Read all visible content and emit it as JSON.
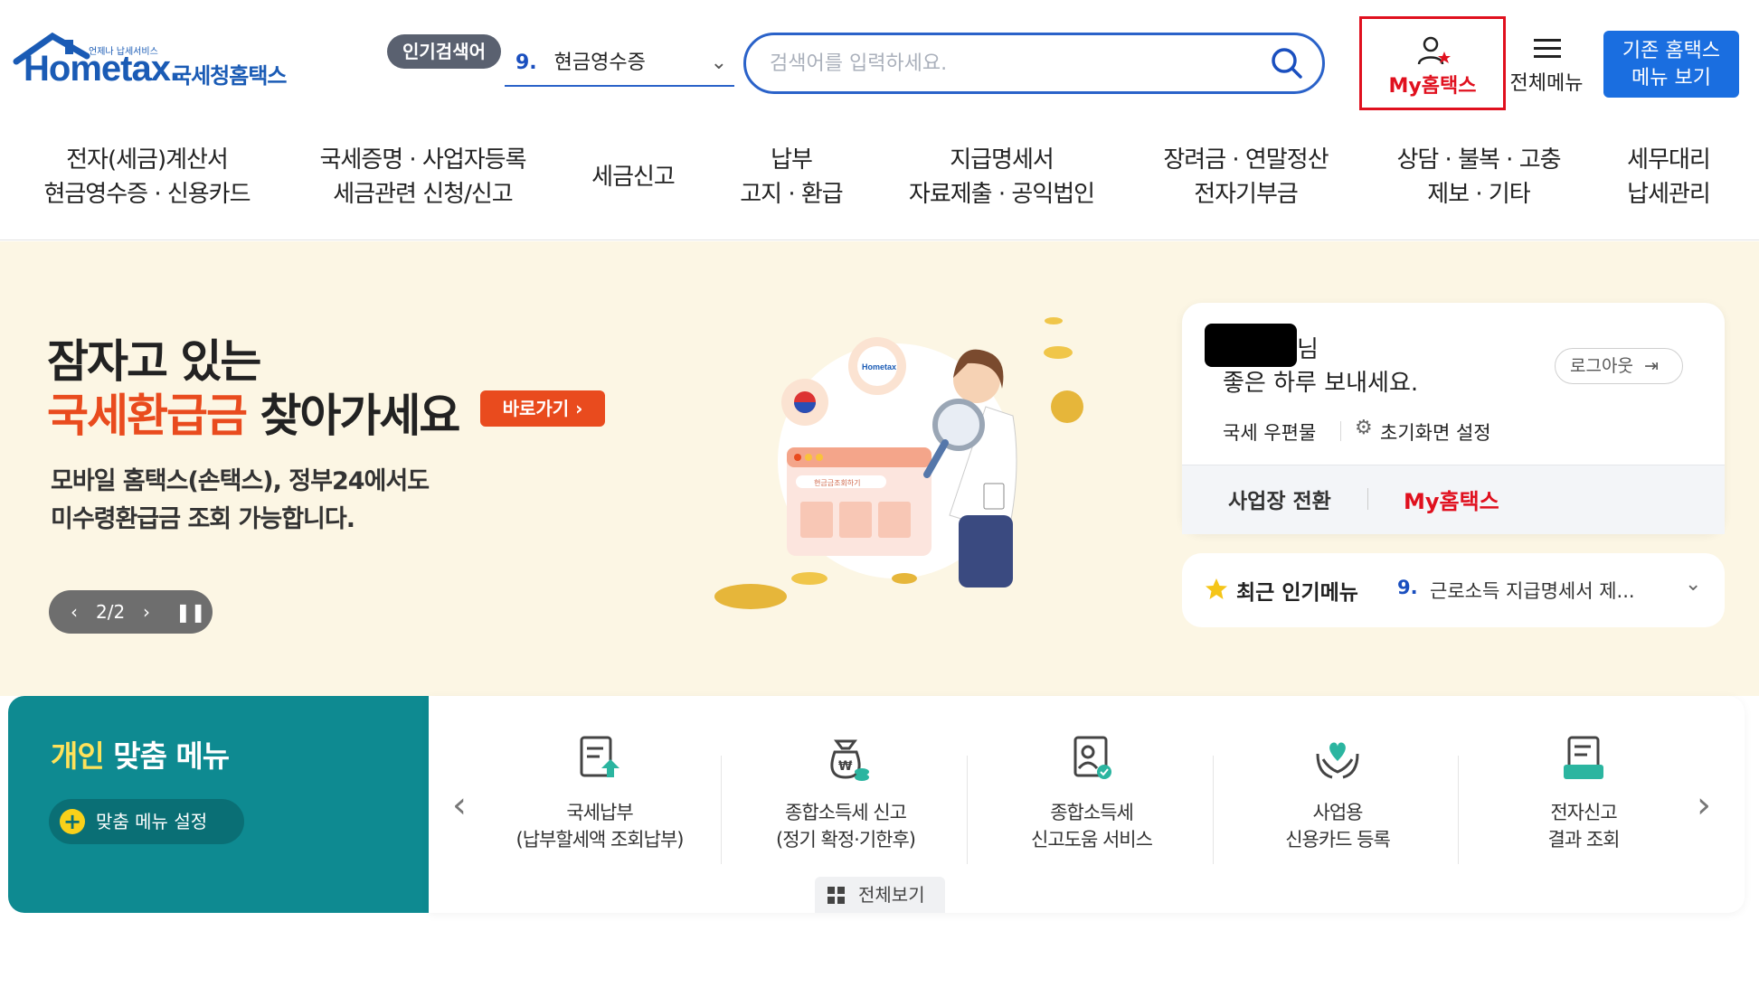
{
  "header": {
    "logo_small": "언제나 납세서비스",
    "logo_en": "Hometax.",
    "logo_ko": "국세청홈택스",
    "popular_badge": "인기검색어",
    "popular_rank": "9.",
    "popular_term": "현금영수증",
    "search_placeholder": "검색어를 입력하세요.",
    "my_hometax": "My홈택스",
    "all_menu": "전체메뉴",
    "old_menu_line1": "기존 홈택스",
    "old_menu_line2": "메뉴 보기"
  },
  "nav": [
    {
      "l1": "전자(세금)계산서",
      "l2": "현금영수증 · 신용카드"
    },
    {
      "l1": "국세증명 · 사업자등록",
      "l2": "세금관련 신청/신고"
    },
    {
      "l1": "세금신고",
      "l2": ""
    },
    {
      "l1": "납부",
      "l2": "고지 · 환급"
    },
    {
      "l1": "지급명세서",
      "l2": "자료제출 · 공익법인"
    },
    {
      "l1": "장려금 · 연말정산",
      "l2": "전자기부금"
    },
    {
      "l1": "상담 · 불복 · 고충",
      "l2": "제보 · 기타"
    },
    {
      "l1": "세무대리",
      "l2": "납세관리"
    }
  ],
  "banner": {
    "line1": "잠자고 있는",
    "line2_red": "국세환급금",
    "line2_rest": " 찾아가세요",
    "go_button": "바로가기 ›",
    "desc1": "모바일 홈택스(손택스), 정부24에서도",
    "desc2": "미수령환급금 조회 가능합니다.",
    "pager": "2/2",
    "laptop_label": "현금금조회하기",
    "badge_label": "Hometax"
  },
  "user_card": {
    "name_suffix": "님",
    "greeting": "좋은 하루 보내세요.",
    "logout": "로그아웃",
    "link_mailbox": "국세 우편물",
    "link_home_setting": "초기화면 설정",
    "switch_workplace": "사업장 전환",
    "my_hometax": "My홈택스"
  },
  "recent_menu": {
    "title": "최근 인기메뉴",
    "rank": "9.",
    "value": "근로소득 지급명세서 제..."
  },
  "custom_menu": {
    "title_yellow": "개인",
    "title_rest": " 맞춤 메뉴",
    "settings": "맞춤 메뉴 설정",
    "view_all": "전체보기",
    "items": [
      {
        "l1": "국세납부",
        "l2": "(납부할세액 조회납부)",
        "icon": "tax-payment-icon"
      },
      {
        "l1": "종합소득세 신고",
        "l2": "(정기 확정·기한후)",
        "icon": "money-bag-icon"
      },
      {
        "l1": "종합소득세",
        "l2": "신고도움 서비스",
        "icon": "help-document-icon"
      },
      {
        "l1": "사업용",
        "l2": "신용카드 등록",
        "icon": "heart-hands-icon"
      },
      {
        "l1": "전자신고",
        "l2": "결과 조회",
        "icon": "filing-result-icon"
      }
    ]
  },
  "colors": {
    "brand_blue": "#1a5bb5",
    "accent_red": "#e0101e",
    "banner_orange": "#e94b1e",
    "teal": "#0e8a91",
    "banner_bg": "#fcf6e4"
  }
}
